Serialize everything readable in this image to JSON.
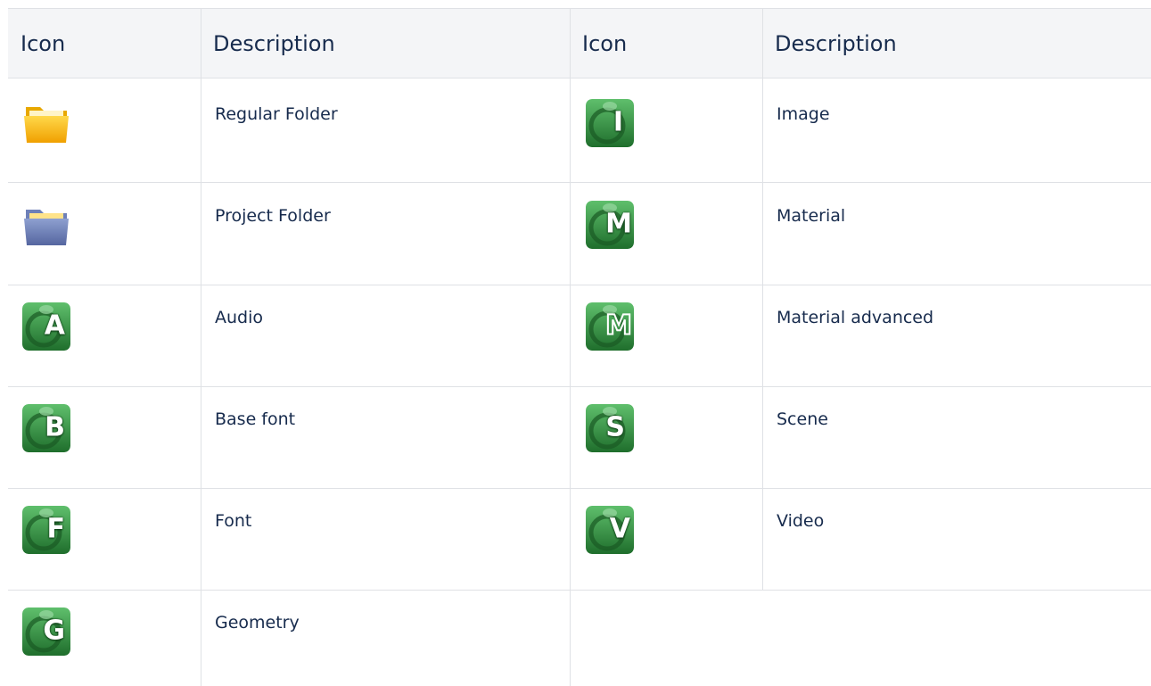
{
  "table": {
    "headers": [
      "Icon",
      "Description",
      "Icon",
      "Description"
    ],
    "left_rows": [
      {
        "icon": "regular-folder-icon",
        "letter": "",
        "description": "Regular Folder"
      },
      {
        "icon": "project-folder-icon",
        "letter": "",
        "description": "Project Folder"
      },
      {
        "icon": "audio-icon",
        "letter": "A",
        "description": "Audio"
      },
      {
        "icon": "base-font-icon",
        "letter": "B",
        "description": "Base font"
      },
      {
        "icon": "font-icon",
        "letter": "F",
        "description": "Font"
      },
      {
        "icon": "geometry-icon",
        "letter": "G",
        "description": "Geometry"
      }
    ],
    "right_rows": [
      {
        "icon": "image-icon",
        "letter": "I",
        "description": "Image"
      },
      {
        "icon": "material-icon",
        "letter": "M",
        "description": "Material"
      },
      {
        "icon": "material-advanced-icon",
        "letter": "M",
        "description": "Material advanced"
      },
      {
        "icon": "scene-icon",
        "letter": "S",
        "description": "Scene"
      },
      {
        "icon": "video-icon",
        "letter": "V",
        "description": "Video"
      }
    ]
  },
  "colors": {
    "header_bg": "#f4f5f7",
    "border": "#dfe1e5",
    "text": "#172b4d",
    "regular_folder": "#f5b800",
    "project_folder": "#6b7fb5",
    "app_icon_green": "#2e8b3e"
  }
}
